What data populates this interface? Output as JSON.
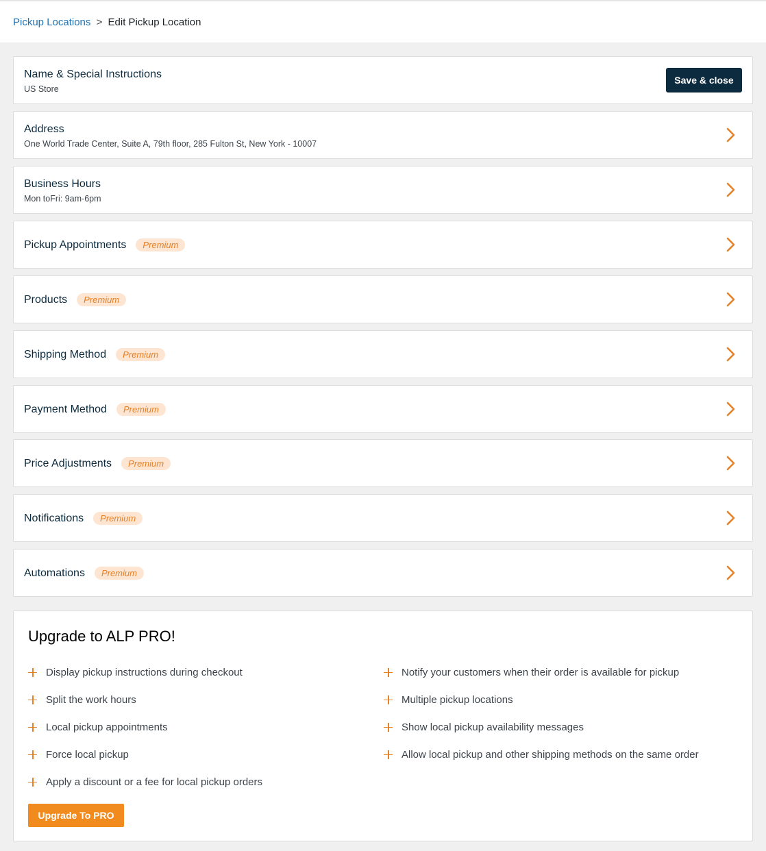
{
  "breadcrumb": {
    "parent": "Pickup Locations",
    "separator": ">",
    "current": "Edit Pickup Location"
  },
  "name_card": {
    "title": "Name & Special Instructions",
    "subtitle": "US Store",
    "save_label": "Save & close"
  },
  "address": {
    "title": "Address",
    "subtitle": "One World Trade Center, Suite A, 79th floor, 285 Fulton St, New York - 10007"
  },
  "hours": {
    "title": "Business Hours",
    "subtitle": "Mon toFri: 9am-6pm"
  },
  "premium_label": "Premium",
  "sections": [
    {
      "title": "Pickup Appointments"
    },
    {
      "title": "Products"
    },
    {
      "title": "Shipping Method"
    },
    {
      "title": "Payment Method"
    },
    {
      "title": "Price Adjustments"
    },
    {
      "title": "Notifications"
    },
    {
      "title": "Automations"
    }
  ],
  "upgrade": {
    "title": "Upgrade to ALP PRO!",
    "left_features": [
      "Display pickup instructions during checkout",
      "Split the work hours",
      "Local pickup appointments",
      "Force local pickup",
      "Apply a discount or a fee for local pickup orders"
    ],
    "right_features": [
      "Notify your customers when their order is available for pickup",
      "Multiple pickup locations",
      "Show local pickup availability messages",
      "Allow local pickup and other shipping methods on the same order"
    ],
    "button_label": "Upgrade To PRO"
  },
  "colors": {
    "accent": "#e68127",
    "dark_button": "#0d2b3e",
    "link": "#2271b1",
    "premium_bg": "#fde5d1"
  },
  "icons": {
    "chevron": "chevron-right-icon",
    "feature": "plus-icon"
  }
}
